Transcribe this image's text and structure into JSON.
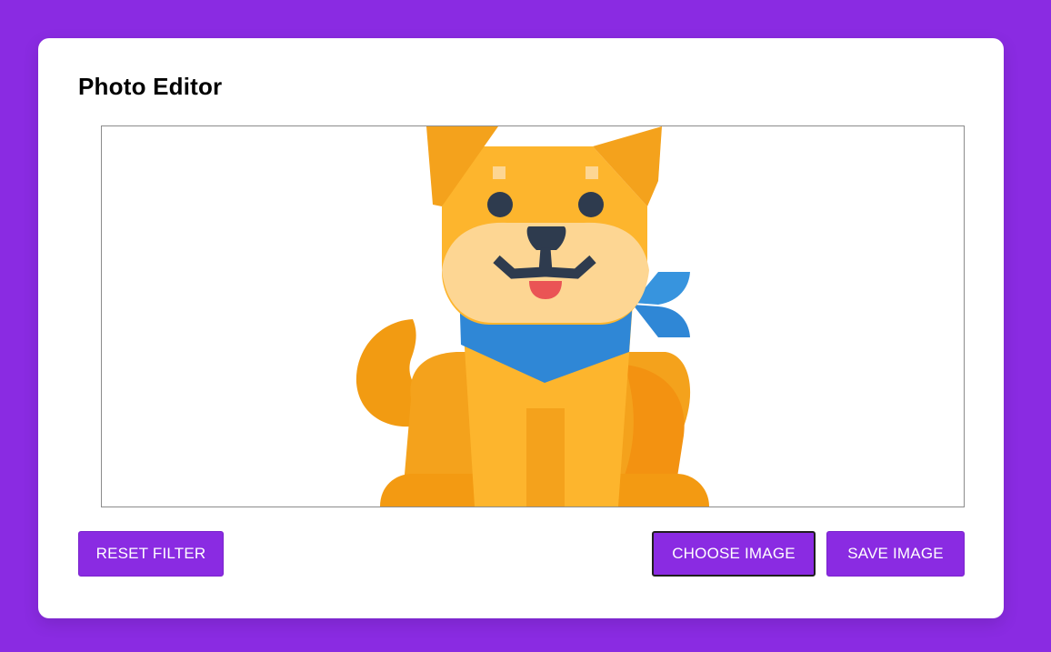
{
  "editor": {
    "title": "Photo Editor",
    "preview_image": "shiba-dog-illustration",
    "buttons": {
      "reset_label": "RESET FILTER",
      "choose_label": "CHOOSE IMAGE",
      "save_label": "SAVE IMAGE"
    },
    "colors": {
      "background": "#8a2be2",
      "button": "#8a2be2",
      "card": "#ffffff"
    }
  }
}
